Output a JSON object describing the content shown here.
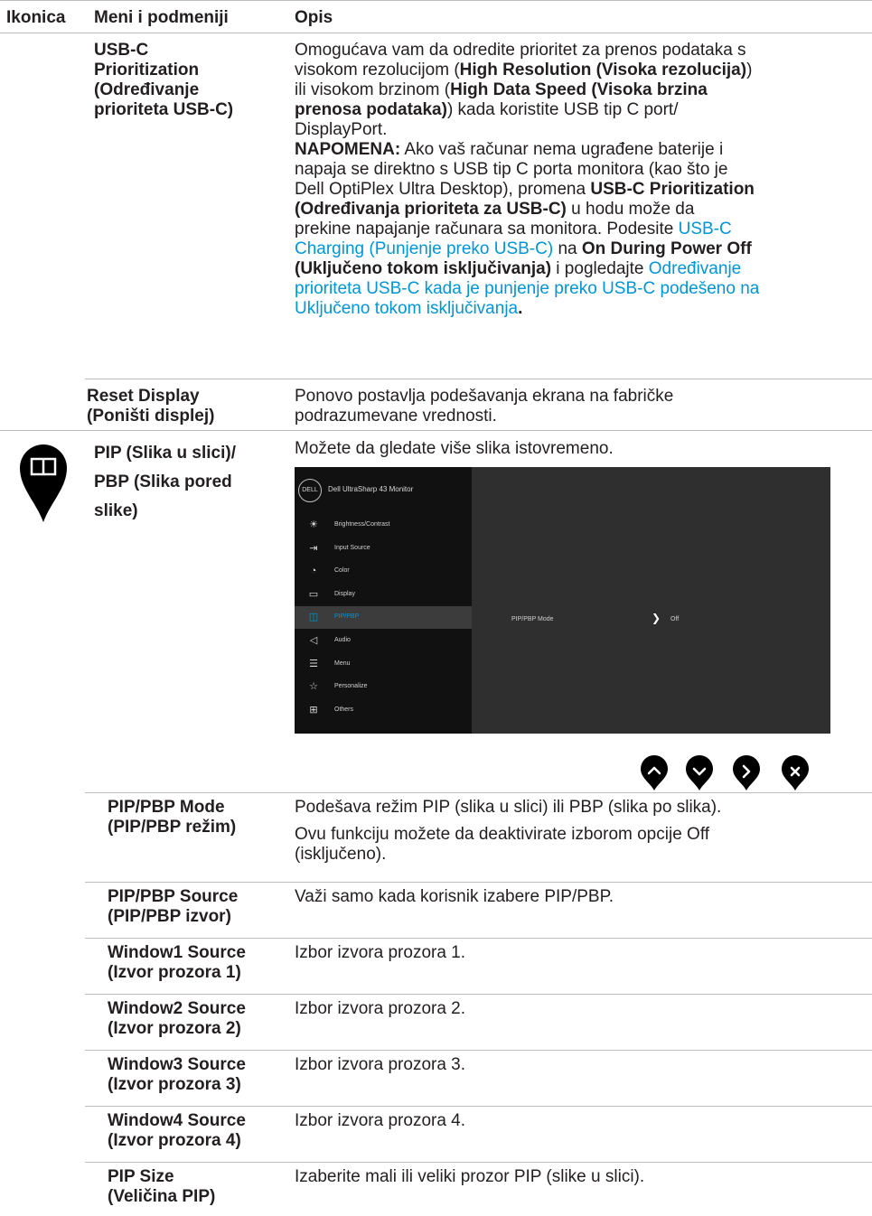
{
  "header": {
    "col1": "Ikonica",
    "col2": "Meni i podmeniji",
    "col3": "Opis"
  },
  "rows": {
    "usbc": {
      "name": "USB-C Prioritization (Određivanje prioriteta USB-C)",
      "name_lines": [
        "USB-C",
        "Prioritization",
        "(Određivanje",
        "prioriteta USB-C)"
      ],
      "desc_lines": [
        [
          {
            "t": "Omogućava vam da odredite prioritet za prenos podataka s"
          }
        ],
        [
          {
            "t": "visokom rezolucijom ("
          },
          {
            "t": "High Resolution (Visoka rezolucija)",
            "b": true
          },
          {
            "t": ")"
          }
        ],
        [
          {
            "t": "ili visokom brzinom ("
          },
          {
            "t": "High Data Speed (Visoka brzina",
            "b": true
          }
        ],
        [
          {
            "t": "prenosa podataka)",
            "b": true
          },
          {
            "t": ") kada koristite USB tip C port/"
          }
        ],
        [
          {
            "t": "DisplayPort."
          }
        ],
        [
          {
            "t": "NAPOMENA:",
            "b": true
          },
          {
            "t": " Ako vaš računar nema ugrađene baterije i"
          }
        ],
        [
          {
            "t": "napaja se direktno s USB tip C porta monitora (kao što je"
          }
        ],
        [
          {
            "t": "Dell OptiPlex Ultra Desktop), promena "
          },
          {
            "t": "USB-C Prioritization",
            "b": true
          }
        ],
        [
          {
            "t": "(Određivanja prioriteta za USB-C)",
            "b": true
          },
          {
            "t": " u hodu može da"
          }
        ],
        [
          {
            "t": "prekine napajanje računara sa monitora. Podesite "
          },
          {
            "t": "USB-C",
            "l": true
          }
        ],
        [
          {
            "t": "Charging (Punjenje preko USB-C)",
            "l": true
          },
          {
            "t": " na "
          },
          {
            "t": "On During Power Off",
            "b": true
          }
        ],
        [
          {
            "t": "(Uključeno tokom isključivanja)",
            "b": true
          },
          {
            "t": " i pogledajte "
          },
          {
            "t": "Određivanje",
            "l": true
          }
        ],
        [
          {
            "t": "prioriteta USB-C kada je punjenje preko USB-C podešeno na",
            "l": true
          }
        ],
        [
          {
            "t": "Uključeno tokom isključivanja",
            "l": true
          },
          {
            "t": ".",
            "b": true
          }
        ]
      ]
    },
    "reset": {
      "name_lines": [
        "Reset Display",
        "(Poništi displej)"
      ],
      "desc_lines": [
        "Ponovo postavlja podešavanja ekrana na fabričke",
        "podrazumevane vrednosti."
      ]
    },
    "pip": {
      "icon": "pip-pbp-icon",
      "name_lines": [
        "PIP (Slika u slici)/",
        "PBP (Slika pored",
        "slike)"
      ],
      "desc": "Možete da gledate više slika istovremeno."
    }
  },
  "osd": {
    "logo": "DELL",
    "title": "Dell UltraSharp 43 Monitor",
    "menu": [
      {
        "label": "Brightness/Contrast",
        "icon": "sun-icon"
      },
      {
        "label": "Input Source",
        "icon": "input-icon"
      },
      {
        "label": "Color",
        "icon": "palette-icon"
      },
      {
        "label": "Display",
        "icon": "monitor-icon"
      },
      {
        "label": "PIP/PBP",
        "icon": "pip-icon"
      },
      {
        "label": "Audio",
        "icon": "speaker-icon"
      },
      {
        "label": "Menu",
        "icon": "menu-icon"
      },
      {
        "label": "Personalize",
        "icon": "star-icon"
      },
      {
        "label": "Others",
        "icon": "others-icon"
      }
    ],
    "selected": "PIP/PBP",
    "sub_label": "PIP/PBP Mode",
    "sub_value": "Off"
  },
  "nav_buttons": [
    "up-icon",
    "down-icon",
    "right-icon",
    "close-icon"
  ],
  "subrows": [
    {
      "name_lines": [
        "PIP/PBP Mode",
        "(PIP/PBP režim)"
      ],
      "desc_lines": [
        "Podešava režim PIP (slika u slici) ili PBP (slika po slika).",
        "Ovu funkciju možete da deaktivirate izborom opcije Off",
        "(isključeno)."
      ]
    },
    {
      "name_lines": [
        "PIP/PBP Source",
        "(PIP/PBP izvor)"
      ],
      "desc_lines": [
        "Važi samo kada korisnik izabere PIP/PBP."
      ]
    },
    {
      "name_lines": [
        "Window1 Source",
        "(Izvor prozora 1)"
      ],
      "desc_lines": [
        "Izbor izvora prozora 1."
      ]
    },
    {
      "name_lines": [
        "Window2 Source",
        "(Izvor prozora 2)"
      ],
      "desc_lines": [
        "Izbor izvora prozora 2."
      ]
    },
    {
      "name_lines": [
        "Window3 Source",
        "(Izvor prozora 3)"
      ],
      "desc_lines": [
        "Izbor izvora prozora 3."
      ]
    },
    {
      "name_lines": [
        "Window4 Source",
        "(Izvor prozora 4)"
      ],
      "desc_lines": [
        "Izbor izvora prozora 4."
      ]
    },
    {
      "name_lines": [
        "PIP Size",
        "(Veličina PIP)"
      ],
      "desc_lines": [
        "Izaberite mali ili veliki prozor PIP (slike u slici)."
      ]
    }
  ],
  "colors": {
    "link": "#0096d6",
    "rule": "#bcbec0",
    "text": "#231f20"
  }
}
